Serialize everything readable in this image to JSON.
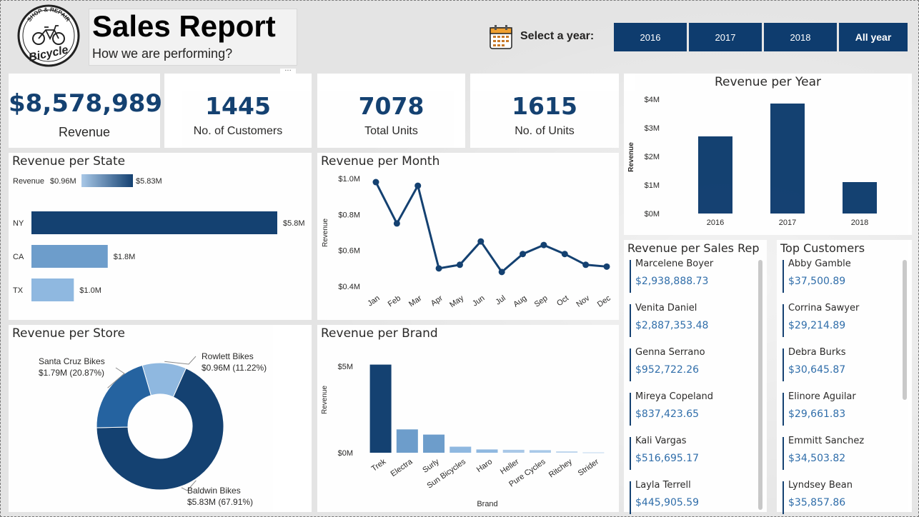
{
  "header": {
    "title": "Sales Report",
    "subtitle": "How we are performing?",
    "logo_top_text": "SHOP & REPAIR",
    "logo_bottom_text": "Bicycle",
    "select_year_label": "Select a year:",
    "year_buttons": [
      "2016",
      "2017",
      "2018",
      "All year"
    ]
  },
  "kpis": [
    {
      "value": "$8,578,989",
      "label": "Revenue"
    },
    {
      "value": "1445",
      "label": "No. of Customers"
    },
    {
      "value": "7078",
      "label": "Total Units"
    },
    {
      "value": "1615",
      "label": "No. of Units"
    }
  ],
  "chart_data": [
    {
      "id": "state",
      "type": "bar",
      "title": "Revenue per State",
      "legend": {
        "label": "Revenue",
        "min": "$0.96M",
        "max": "$5.83M"
      },
      "categories": [
        "NY",
        "CA",
        "TX"
      ],
      "values": [
        5.8,
        1.8,
        1.0
      ],
      "data_labels": [
        "$5.8M",
        "$1.8M",
        "$1.0M"
      ],
      "colors": [
        "#0e3c6e",
        "#6a9bcb",
        "#8db7e0"
      ],
      "xlim": [
        0,
        5.8
      ]
    },
    {
      "id": "month",
      "type": "line",
      "title": "Revenue per Month",
      "ylabel": "Revenue",
      "categories": [
        "Jan",
        "Feb",
        "Mar",
        "Apr",
        "May",
        "Jun",
        "Jul",
        "Aug",
        "Sep",
        "Oct",
        "Nov",
        "Dec"
      ],
      "values": [
        0.98,
        0.75,
        0.96,
        0.5,
        0.52,
        0.65,
        0.48,
        0.58,
        0.63,
        0.58,
        0.52,
        0.51
      ],
      "yticks": [
        "$1.0M",
        "$0.8M",
        "$0.6M",
        "$0.4M"
      ],
      "ylim": [
        0.4,
        1.0
      ]
    },
    {
      "id": "year",
      "type": "bar",
      "title": "Revenue per Year",
      "ylabel": "Revenue",
      "categories": [
        "2016",
        "2017",
        "2018"
      ],
      "values": [
        2.7,
        3.85,
        1.1
      ],
      "yticks": [
        "$4M",
        "$3M",
        "$2M",
        "$1M",
        "$0M"
      ],
      "ylim": [
        0,
        4
      ]
    },
    {
      "id": "store",
      "type": "pie",
      "title": "Revenue per Store",
      "slices": [
        {
          "name": "Baldwin Bikes",
          "value": 5.83,
          "label": "$5.83M (67.91%)",
          "color": "#0e3c6e"
        },
        {
          "name": "Santa Cruz Bikes",
          "value": 1.79,
          "label": "$1.79M (20.87%)",
          "color": "#1f5f9e"
        },
        {
          "name": "Rowlett Bikes",
          "value": 0.96,
          "label": "$0.96M (11.22%)",
          "color": "#8db7e0"
        }
      ]
    },
    {
      "id": "brand",
      "type": "bar",
      "title": "Revenue per Brand",
      "xlabel": "Brand",
      "ylabel": "Revenue",
      "categories": [
        "Trek",
        "Electra",
        "Surly",
        "Sun Bicycles",
        "Haro",
        "Heller",
        "Pure Cycles",
        "Ritchey",
        "Strider"
      ],
      "values": [
        5.1,
        1.35,
        1.05,
        0.35,
        0.19,
        0.17,
        0.15,
        0.08,
        0.02
      ],
      "colors": [
        "#0e3c6e",
        "#6a9bcb",
        "#6a9bcb",
        "#8db7e0",
        "#8db7e0",
        "#a7c8e8",
        "#a7c8e8",
        "#bcd5ee",
        "#bcd5ee"
      ],
      "yticks": [
        "$5M",
        "$0M"
      ],
      "ylim": [
        0,
        5
      ]
    }
  ],
  "sales_reps": {
    "title": "Revenue per Sales Rep",
    "items": [
      {
        "name": "Marcelene Boyer",
        "value": "$2,938,888.73"
      },
      {
        "name": "Venita Daniel",
        "value": "$2,887,353.48"
      },
      {
        "name": "Genna Serrano",
        "value": "$952,722.26"
      },
      {
        "name": "Mireya Copeland",
        "value": "$837,423.65"
      },
      {
        "name": "Kali Vargas",
        "value": "$516,695.17"
      },
      {
        "name": "Layla Terrell",
        "value": "$445,905.59"
      }
    ]
  },
  "top_customers": {
    "title": "Top Customers",
    "items": [
      {
        "name": "Abby Gamble",
        "value": "$37,500.89"
      },
      {
        "name": "Corrina Sawyer",
        "value": "$29,214.89"
      },
      {
        "name": "Debra Burks",
        "value": "$30,645.87"
      },
      {
        "name": "Elinore Aguilar",
        "value": "$29,661.83"
      },
      {
        "name": "Emmitt Sanchez",
        "value": "$34,503.82"
      },
      {
        "name": "Lyndsey Bean",
        "value": "$35,857.86"
      }
    ]
  },
  "colors": {
    "primary": "#0e3c6e",
    "value_text": "#2a6aa8",
    "background": "#e4e4e4"
  },
  "icons": {
    "calendar": "calendar-icon",
    "logo": "bicycle-logo-icon"
  }
}
